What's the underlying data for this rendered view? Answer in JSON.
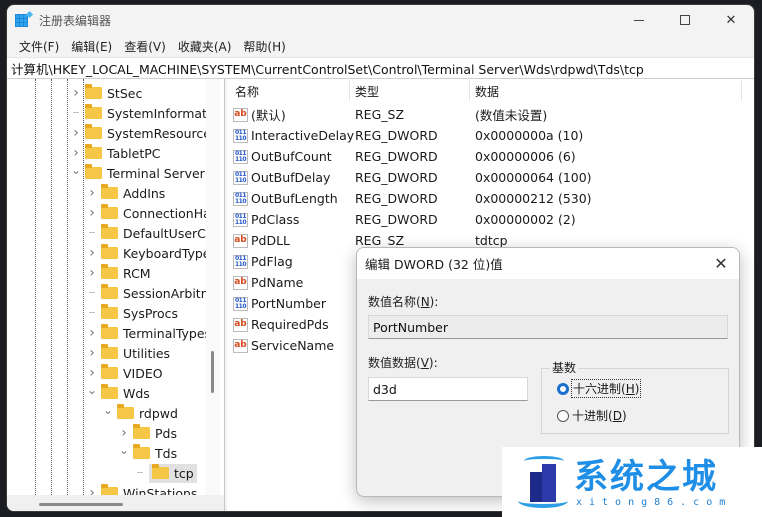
{
  "window": {
    "title": "注册表编辑器",
    "controls": {
      "minimize": "minimize",
      "maximize": "maximize",
      "close": "✕"
    }
  },
  "menu": [
    "文件(F)",
    "编辑(E)",
    "查看(V)",
    "收藏夹(A)",
    "帮助(H)"
  ],
  "address": "计算机\\HKEY_LOCAL_MACHINE\\SYSTEM\\CurrentControlSet\\Control\\Terminal Server\\Wds\\rdpwd\\Tds\\tcp",
  "tree": [
    {
      "label": "StSec",
      "level": 0,
      "expander": "collapsed"
    },
    {
      "label": "SystemInformatio",
      "level": 0,
      "expander": "none"
    },
    {
      "label": "SystemResources",
      "level": 0,
      "expander": "collapsed"
    },
    {
      "label": "TabletPC",
      "level": 0,
      "expander": "collapsed"
    },
    {
      "label": "Terminal Server",
      "level": 0,
      "expander": "expanded"
    },
    {
      "label": "AddIns",
      "level": 1,
      "expander": "collapsed"
    },
    {
      "label": "ConnectionHan",
      "level": 1,
      "expander": "collapsed"
    },
    {
      "label": "DefaultUserCor",
      "level": 1,
      "expander": "none"
    },
    {
      "label": "KeyboardType",
      "level": 1,
      "expander": "collapsed"
    },
    {
      "label": "RCM",
      "level": 1,
      "expander": "collapsed"
    },
    {
      "label": "SessionArbitrat",
      "level": 1,
      "expander": "none"
    },
    {
      "label": "SysProcs",
      "level": 1,
      "expander": "none"
    },
    {
      "label": "TerminalTypes",
      "level": 1,
      "expander": "collapsed"
    },
    {
      "label": "Utilities",
      "level": 1,
      "expander": "collapsed"
    },
    {
      "label": "VIDEO",
      "level": 1,
      "expander": "collapsed"
    },
    {
      "label": "Wds",
      "level": 1,
      "expander": "expanded"
    },
    {
      "label": "rdpwd",
      "level": 2,
      "expander": "expanded"
    },
    {
      "label": "Pds",
      "level": 3,
      "expander": "collapsed"
    },
    {
      "label": "Tds",
      "level": 3,
      "expander": "expanded"
    },
    {
      "label": "tcp",
      "level": 4,
      "expander": "none",
      "selected": true
    },
    {
      "label": "WinStations",
      "level": 1,
      "expander": "collapsed"
    }
  ],
  "list": {
    "columns": {
      "name": "名称",
      "type": "类型",
      "data": "数据"
    },
    "rows": [
      {
        "icon": "string-value-icon",
        "name": "(默认)",
        "type": "REG_SZ",
        "data": "(数值未设置)"
      },
      {
        "icon": "binary-value-icon",
        "name": "InteractiveDelay",
        "type": "REG_DWORD",
        "data": "0x0000000a (10)"
      },
      {
        "icon": "binary-value-icon",
        "name": "OutBufCount",
        "type": "REG_DWORD",
        "data": "0x00000006 (6)"
      },
      {
        "icon": "binary-value-icon",
        "name": "OutBufDelay",
        "type": "REG_DWORD",
        "data": "0x00000064 (100)"
      },
      {
        "icon": "binary-value-icon",
        "name": "OutBufLength",
        "type": "REG_DWORD",
        "data": "0x00000212 (530)"
      },
      {
        "icon": "binary-value-icon",
        "name": "PdClass",
        "type": "REG_DWORD",
        "data": "0x00000002 (2)"
      },
      {
        "icon": "string-value-icon",
        "name": "PdDLL",
        "type": "REG_SZ",
        "data": "tdtcp"
      },
      {
        "icon": "binary-value-icon",
        "name": "PdFlag",
        "type": "",
        "data": ""
      },
      {
        "icon": "string-value-icon",
        "name": "PdName",
        "type": "",
        "data": ""
      },
      {
        "icon": "binary-value-icon",
        "name": "PortNumber",
        "type": "",
        "data": ""
      },
      {
        "icon": "string-value-icon",
        "name": "RequiredPds",
        "type": "",
        "data": ""
      },
      {
        "icon": "string-value-icon",
        "name": "ServiceName",
        "type": "",
        "data": ""
      }
    ]
  },
  "dialog": {
    "title": "编辑 DWORD (32 位)值",
    "value_name_label": "数值名称(",
    "value_name_key": "N",
    "value_name_suffix": "):",
    "value_name": "PortNumber",
    "value_data_label": "数值数据(",
    "value_data_key": "V",
    "value_data_suffix": "):",
    "value_data": "d3d",
    "base_label": "基数",
    "base_options": [
      {
        "label": "十六进制(",
        "key": "H",
        "suffix": ")",
        "checked": true
      },
      {
        "label": "十进制(",
        "key": "D",
        "suffix": ")",
        "checked": false
      }
    ]
  },
  "watermark": {
    "name": "系统之城",
    "url": "xitong86.com"
  }
}
